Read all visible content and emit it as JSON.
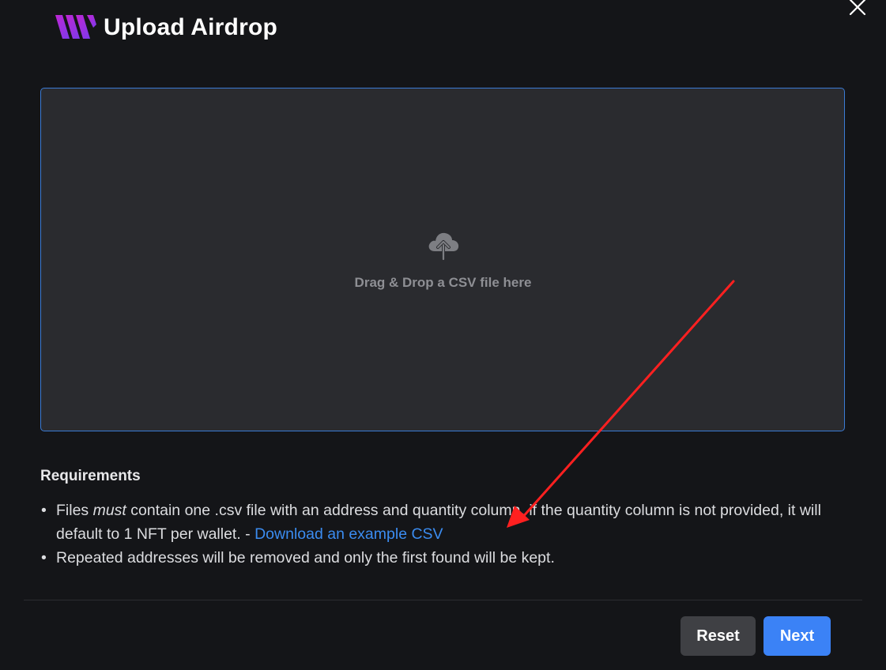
{
  "header": {
    "title": "Upload Airdrop",
    "logo_icon": "brand-w-logo-icon",
    "close_icon": "close-icon"
  },
  "dropzone": {
    "icon": "cloud-upload-icon",
    "text": "Drag & Drop a CSV file here"
  },
  "requirements": {
    "title": "Requirements",
    "items": [
      {
        "pre": "Files ",
        "emphasis": "must",
        "post": " contain one .csv file with an address and quantity column, if the quantity column is not provided, it will default to 1 NFT per wallet. - ",
        "link": "Download an example CSV"
      },
      {
        "text": "Repeated addresses will be removed and only the first found will be kept."
      }
    ]
  },
  "footer": {
    "reset_label": "Reset",
    "next_label": "Next"
  },
  "colors": {
    "background": "#141518",
    "dropzone_bg": "#2a2b2f",
    "dropzone_border": "#3a7bd5",
    "link": "#3b8cf0",
    "primary_button": "#3b82f6",
    "secondary_button": "#3f4044",
    "annotation_arrow": "#ff2020"
  }
}
